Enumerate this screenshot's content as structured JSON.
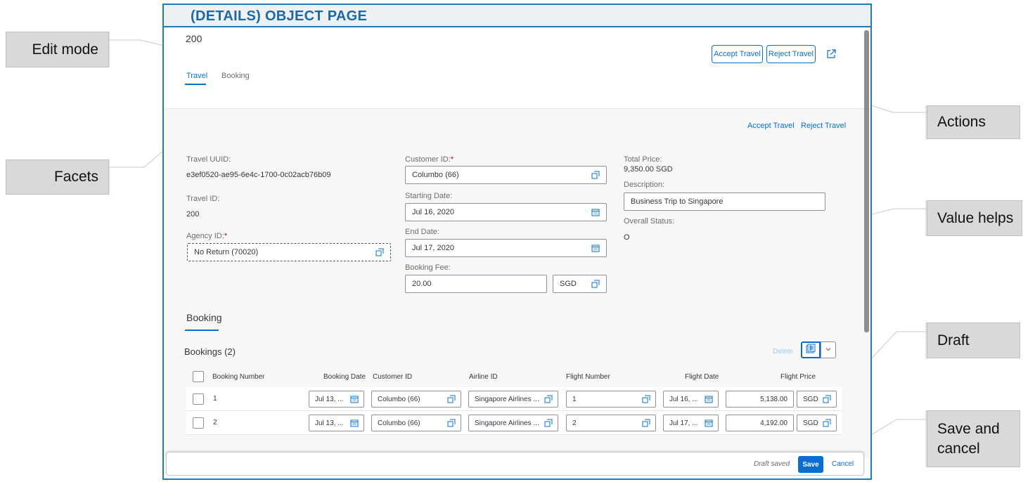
{
  "frame_title": "(DETAILS) OBJECT PAGE",
  "callouts": {
    "edit_mode": "Edit mode",
    "facets": "Facets",
    "actions": "Actions",
    "value_helps": "Value helps",
    "draft": "Draft",
    "save_cancel_1": "Save and",
    "save_cancel_2": "cancel"
  },
  "header": {
    "object_id": "200",
    "accept_label": "Accept Travel",
    "reject_label": "Reject Travel",
    "share_icon": "share-icon"
  },
  "tabs": [
    {
      "label": "Travel",
      "active": true
    },
    {
      "label": "Booking",
      "active": false
    }
  ],
  "section_actions": {
    "accept_label": "Accept Travel",
    "reject_label": "Reject Travel"
  },
  "travel": {
    "uuid_label": "Travel UUID:",
    "uuid_value": "e3ef0520-ae95-6e4c-1700-0c02acb76b09",
    "travel_id_label": "Travel ID:",
    "travel_id_value": "200",
    "agency_label": "Agency ID:",
    "agency_value": "No Return (70020)",
    "customer_label": "Customer ID:",
    "customer_value": "Columbo (66)",
    "start_label": "Starting Date:",
    "start_value": "Jul 16, 2020",
    "end_label": "End Date:",
    "end_value": "Jul 17, 2020",
    "fee_label": "Booking Fee:",
    "fee_value": "20.00",
    "fee_currency": "SGD",
    "total_label": "Total Price:",
    "total_value": "9,350.00  SGD",
    "desc_label": "Description:",
    "desc_value": "Business Trip to Singapore",
    "status_label": "Overall Status:",
    "status_value": "O",
    "required_mark": "*"
  },
  "booking_section": {
    "title": "Booking",
    "table_title": "Bookings (2)",
    "delete_label": "Delete",
    "columns": [
      "Booking Number",
      "Booking Date",
      "Customer ID",
      "Airline ID",
      "Flight Number",
      "Flight Date",
      "Flight Price"
    ],
    "rows": [
      {
        "number": "1",
        "booking_date": "Jul 13, ...",
        "customer": "Columbo (66)",
        "airline": "Singapore Airlines ...",
        "flight_number": "1",
        "flight_date": "Jul 16, ...",
        "price": "5,138.00",
        "currency": "SGD"
      },
      {
        "number": "2",
        "booking_date": "Jul 13, ...",
        "customer": "Columbo (66)",
        "airline": "Singapore Airlines ...",
        "flight_number": "2",
        "flight_date": "Jul 17, ...",
        "price": "4,192.00",
        "currency": "SGD"
      }
    ]
  },
  "footer": {
    "draft_status": "Draft saved",
    "save_label": "Save",
    "cancel_label": "Cancel"
  },
  "colors": {
    "accent": "#0a6ed1",
    "frame_border": "#1f7ab8",
    "title_text": "#1b6aa8",
    "callout_bg": "#d9d9d9"
  }
}
